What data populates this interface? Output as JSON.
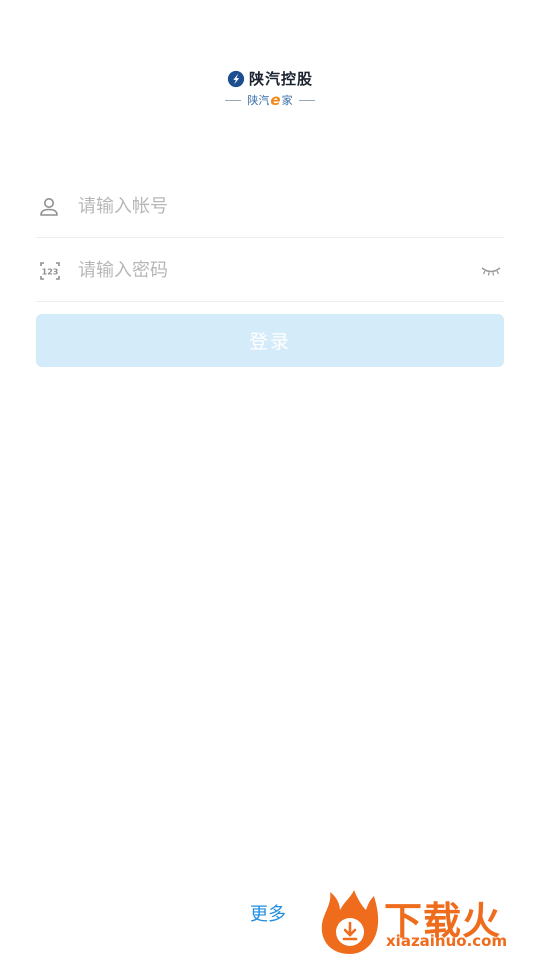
{
  "logo": {
    "title": "陕汽控股",
    "subtitle_prefix": "陕汽",
    "subtitle_e": "e",
    "subtitle_suffix": "家",
    "brand_color": "#1c2430",
    "accent_color": "#f08a1c"
  },
  "form": {
    "account_placeholder": "请输入帐号",
    "password_placeholder": "请输入密码",
    "account_icon": "user-icon",
    "password_icon": "numeric-keyboard-icon",
    "password_toggle_icon": "eye-closed-icon",
    "login_label": "登录",
    "login_button_color": "#d4ebfa"
  },
  "footer": {
    "more_label": "更多",
    "link_color": "#1f8ee2"
  },
  "watermark": {
    "title": "下载火",
    "subtitle": "xiazaihuo.com"
  }
}
